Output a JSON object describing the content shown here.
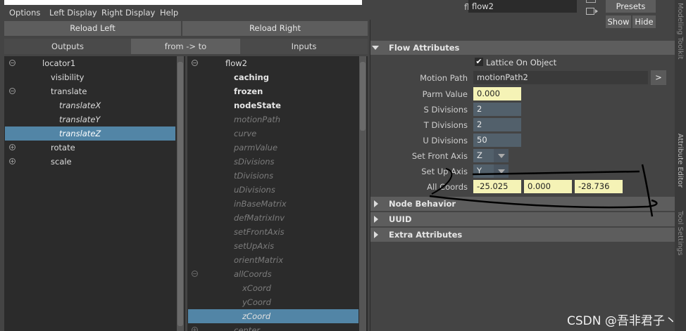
{
  "menu": [
    "Options",
    "Left Display",
    "Right Display",
    "Help"
  ],
  "buttons": {
    "reload_left": "Reload Left",
    "reload_right": "Reload Right"
  },
  "tabs": {
    "outputs": "Outputs",
    "from_to": "from -> to",
    "inputs": "Inputs"
  },
  "left_tree": {
    "root": "locator1",
    "items": [
      "visibility",
      "translate",
      "translateX",
      "translateY",
      "translateZ",
      "rotate",
      "scale"
    ]
  },
  "right_tree": {
    "root": "flow2",
    "bold": [
      "caching",
      "frozen",
      "nodeState"
    ],
    "dim": [
      "motionPath",
      "curve",
      "parmValue",
      "sDivisions",
      "tDivisions",
      "uDivisions",
      "inBaseMatrix",
      "defMatrixInv",
      "setFrontAxis",
      "setUpAxis",
      "orientMatrix",
      "allCoords",
      "xCoord",
      "yCoord",
      "zCoord",
      "center"
    ]
  },
  "attr": {
    "flow_label": "flow:",
    "flow_value": "flow2",
    "presets": "Presets",
    "show": "Show",
    "hide": "Hide",
    "section_flow": "Flow Attributes",
    "lattice_checkbox": "Lattice On Object",
    "motion_path_label": "Motion Path",
    "motion_path_value": "motionPath2",
    "motion_path_btn": ">",
    "parm_value_label": "Parm Value",
    "parm_value": "0.000",
    "s_div_label": "S Divisions",
    "s_div": "2",
    "t_div_label": "T Divisions",
    "t_div": "2",
    "u_div_label": "U Divisions",
    "u_div": "50",
    "front_axis_label": "Set Front Axis",
    "front_axis": "Z",
    "up_axis_label": "Set Up Axis",
    "up_axis": "Y",
    "all_coords_label": "All Coords",
    "coords": [
      "-25.025",
      "0.000",
      "-28.736"
    ],
    "sections": [
      "Node Behavior",
      "UUID",
      "Extra Attributes"
    ]
  },
  "side_strip": [
    "Modeling Toolkit",
    "Attribute Editor",
    "Tool Settings"
  ],
  "watermark": "CSDN @吾非君子丶",
  "colors": {
    "selection": "#5285a6",
    "field_yellow": "#f5f3b6",
    "field_blue": "#52606b"
  }
}
